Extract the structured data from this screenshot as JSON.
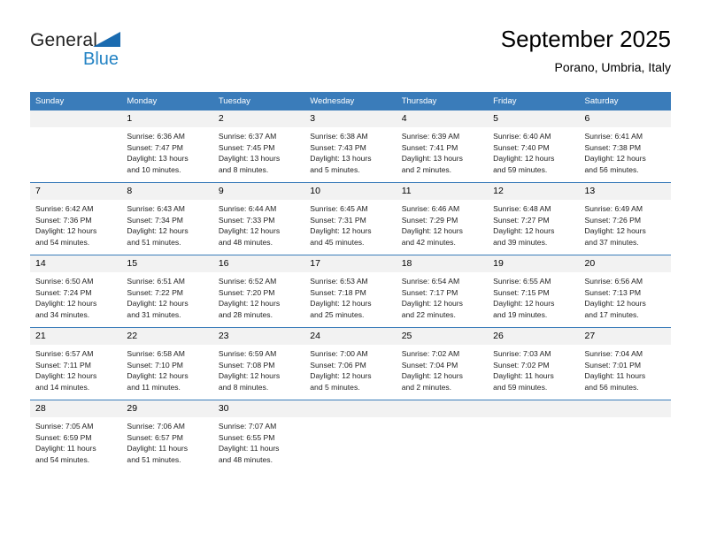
{
  "logo": {
    "primary_text": "General",
    "secondary_text": "Blue",
    "triangle_icon": "blue-triangle-icon",
    "primary_color": "#222222",
    "secondary_color": "#2383c4"
  },
  "header": {
    "title": "September 2025",
    "subtitle": "Porano, Umbria, Italy"
  },
  "colors": {
    "header_row_bg": "#3a7cba",
    "header_row_text": "#ffffff",
    "daynum_bg": "#f2f2f2",
    "cell_bg": "#ffffff",
    "row_divider": "#3a7cba",
    "body_text": "#222222"
  },
  "calendar": {
    "weekday_headers": [
      "Sunday",
      "Monday",
      "Tuesday",
      "Wednesday",
      "Thursday",
      "Friday",
      "Saturday"
    ],
    "weeks": [
      [
        {
          "day": "",
          "empty": true,
          "sunrise": "",
          "sunset": "",
          "daylight_line1": "",
          "daylight_line2": ""
        },
        {
          "day": "1",
          "empty": false,
          "sunrise": "Sunrise: 6:36 AM",
          "sunset": "Sunset: 7:47 PM",
          "daylight_line1": "Daylight: 13 hours",
          "daylight_line2": "and 10 minutes."
        },
        {
          "day": "2",
          "empty": false,
          "sunrise": "Sunrise: 6:37 AM",
          "sunset": "Sunset: 7:45 PM",
          "daylight_line1": "Daylight: 13 hours",
          "daylight_line2": "and 8 minutes."
        },
        {
          "day": "3",
          "empty": false,
          "sunrise": "Sunrise: 6:38 AM",
          "sunset": "Sunset: 7:43 PM",
          "daylight_line1": "Daylight: 13 hours",
          "daylight_line2": "and 5 minutes."
        },
        {
          "day": "4",
          "empty": false,
          "sunrise": "Sunrise: 6:39 AM",
          "sunset": "Sunset: 7:41 PM",
          "daylight_line1": "Daylight: 13 hours",
          "daylight_line2": "and 2 minutes."
        },
        {
          "day": "5",
          "empty": false,
          "sunrise": "Sunrise: 6:40 AM",
          "sunset": "Sunset: 7:40 PM",
          "daylight_line1": "Daylight: 12 hours",
          "daylight_line2": "and 59 minutes."
        },
        {
          "day": "6",
          "empty": false,
          "sunrise": "Sunrise: 6:41 AM",
          "sunset": "Sunset: 7:38 PM",
          "daylight_line1": "Daylight: 12 hours",
          "daylight_line2": "and 56 minutes."
        }
      ],
      [
        {
          "day": "7",
          "empty": false,
          "sunrise": "Sunrise: 6:42 AM",
          "sunset": "Sunset: 7:36 PM",
          "daylight_line1": "Daylight: 12 hours",
          "daylight_line2": "and 54 minutes."
        },
        {
          "day": "8",
          "empty": false,
          "sunrise": "Sunrise: 6:43 AM",
          "sunset": "Sunset: 7:34 PM",
          "daylight_line1": "Daylight: 12 hours",
          "daylight_line2": "and 51 minutes."
        },
        {
          "day": "9",
          "empty": false,
          "sunrise": "Sunrise: 6:44 AM",
          "sunset": "Sunset: 7:33 PM",
          "daylight_line1": "Daylight: 12 hours",
          "daylight_line2": "and 48 minutes."
        },
        {
          "day": "10",
          "empty": false,
          "sunrise": "Sunrise: 6:45 AM",
          "sunset": "Sunset: 7:31 PM",
          "daylight_line1": "Daylight: 12 hours",
          "daylight_line2": "and 45 minutes."
        },
        {
          "day": "11",
          "empty": false,
          "sunrise": "Sunrise: 6:46 AM",
          "sunset": "Sunset: 7:29 PM",
          "daylight_line1": "Daylight: 12 hours",
          "daylight_line2": "and 42 minutes."
        },
        {
          "day": "12",
          "empty": false,
          "sunrise": "Sunrise: 6:48 AM",
          "sunset": "Sunset: 7:27 PM",
          "daylight_line1": "Daylight: 12 hours",
          "daylight_line2": "and 39 minutes."
        },
        {
          "day": "13",
          "empty": false,
          "sunrise": "Sunrise: 6:49 AM",
          "sunset": "Sunset: 7:26 PM",
          "daylight_line1": "Daylight: 12 hours",
          "daylight_line2": "and 37 minutes."
        }
      ],
      [
        {
          "day": "14",
          "empty": false,
          "sunrise": "Sunrise: 6:50 AM",
          "sunset": "Sunset: 7:24 PM",
          "daylight_line1": "Daylight: 12 hours",
          "daylight_line2": "and 34 minutes."
        },
        {
          "day": "15",
          "empty": false,
          "sunrise": "Sunrise: 6:51 AM",
          "sunset": "Sunset: 7:22 PM",
          "daylight_line1": "Daylight: 12 hours",
          "daylight_line2": "and 31 minutes."
        },
        {
          "day": "16",
          "empty": false,
          "sunrise": "Sunrise: 6:52 AM",
          "sunset": "Sunset: 7:20 PM",
          "daylight_line1": "Daylight: 12 hours",
          "daylight_line2": "and 28 minutes."
        },
        {
          "day": "17",
          "empty": false,
          "sunrise": "Sunrise: 6:53 AM",
          "sunset": "Sunset: 7:18 PM",
          "daylight_line1": "Daylight: 12 hours",
          "daylight_line2": "and 25 minutes."
        },
        {
          "day": "18",
          "empty": false,
          "sunrise": "Sunrise: 6:54 AM",
          "sunset": "Sunset: 7:17 PM",
          "daylight_line1": "Daylight: 12 hours",
          "daylight_line2": "and 22 minutes."
        },
        {
          "day": "19",
          "empty": false,
          "sunrise": "Sunrise: 6:55 AM",
          "sunset": "Sunset: 7:15 PM",
          "daylight_line1": "Daylight: 12 hours",
          "daylight_line2": "and 19 minutes."
        },
        {
          "day": "20",
          "empty": false,
          "sunrise": "Sunrise: 6:56 AM",
          "sunset": "Sunset: 7:13 PM",
          "daylight_line1": "Daylight: 12 hours",
          "daylight_line2": "and 17 minutes."
        }
      ],
      [
        {
          "day": "21",
          "empty": false,
          "sunrise": "Sunrise: 6:57 AM",
          "sunset": "Sunset: 7:11 PM",
          "daylight_line1": "Daylight: 12 hours",
          "daylight_line2": "and 14 minutes."
        },
        {
          "day": "22",
          "empty": false,
          "sunrise": "Sunrise: 6:58 AM",
          "sunset": "Sunset: 7:10 PM",
          "daylight_line1": "Daylight: 12 hours",
          "daylight_line2": "and 11 minutes."
        },
        {
          "day": "23",
          "empty": false,
          "sunrise": "Sunrise: 6:59 AM",
          "sunset": "Sunset: 7:08 PM",
          "daylight_line1": "Daylight: 12 hours",
          "daylight_line2": "and 8 minutes."
        },
        {
          "day": "24",
          "empty": false,
          "sunrise": "Sunrise: 7:00 AM",
          "sunset": "Sunset: 7:06 PM",
          "daylight_line1": "Daylight: 12 hours",
          "daylight_line2": "and 5 minutes."
        },
        {
          "day": "25",
          "empty": false,
          "sunrise": "Sunrise: 7:02 AM",
          "sunset": "Sunset: 7:04 PM",
          "daylight_line1": "Daylight: 12 hours",
          "daylight_line2": "and 2 minutes."
        },
        {
          "day": "26",
          "empty": false,
          "sunrise": "Sunrise: 7:03 AM",
          "sunset": "Sunset: 7:02 PM",
          "daylight_line1": "Daylight: 11 hours",
          "daylight_line2": "and 59 minutes."
        },
        {
          "day": "27",
          "empty": false,
          "sunrise": "Sunrise: 7:04 AM",
          "sunset": "Sunset: 7:01 PM",
          "daylight_line1": "Daylight: 11 hours",
          "daylight_line2": "and 56 minutes."
        }
      ],
      [
        {
          "day": "28",
          "empty": false,
          "sunrise": "Sunrise: 7:05 AM",
          "sunset": "Sunset: 6:59 PM",
          "daylight_line1": "Daylight: 11 hours",
          "daylight_line2": "and 54 minutes."
        },
        {
          "day": "29",
          "empty": false,
          "sunrise": "Sunrise: 7:06 AM",
          "sunset": "Sunset: 6:57 PM",
          "daylight_line1": "Daylight: 11 hours",
          "daylight_line2": "and 51 minutes."
        },
        {
          "day": "30",
          "empty": false,
          "sunrise": "Sunrise: 7:07 AM",
          "sunset": "Sunset: 6:55 PM",
          "daylight_line1": "Daylight: 11 hours",
          "daylight_line2": "and 48 minutes."
        },
        {
          "day": "",
          "empty": true,
          "sunrise": "",
          "sunset": "",
          "daylight_line1": "",
          "daylight_line2": ""
        },
        {
          "day": "",
          "empty": true,
          "sunrise": "",
          "sunset": "",
          "daylight_line1": "",
          "daylight_line2": ""
        },
        {
          "day": "",
          "empty": true,
          "sunrise": "",
          "sunset": "",
          "daylight_line1": "",
          "daylight_line2": ""
        },
        {
          "day": "",
          "empty": true,
          "sunrise": "",
          "sunset": "",
          "daylight_line1": "",
          "daylight_line2": ""
        }
      ]
    ]
  }
}
